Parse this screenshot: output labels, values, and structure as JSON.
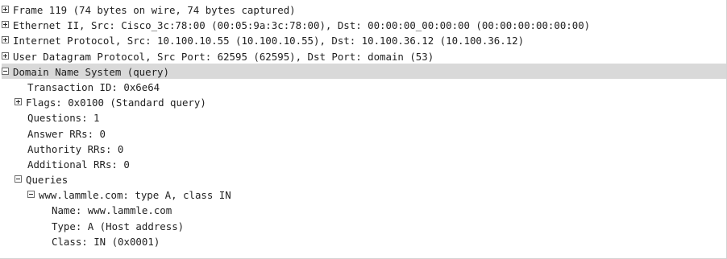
{
  "packet_details": {
    "rows": [
      {
        "text": "Frame 119 (74 bytes on wire, 74 bytes captured)",
        "expander": "collapsed"
      },
      {
        "text": "Ethernet II, Src: Cisco_3c:78:00 (00:05:9a:3c:78:00), Dst: 00:00:00_00:00:00 (00:00:00:00:00:00)",
        "expander": "collapsed"
      },
      {
        "text": "Internet Protocol, Src: 10.100.10.55 (10.100.10.55), Dst: 10.100.36.12 (10.100.36.12)",
        "expander": "collapsed"
      },
      {
        "text": "User Datagram Protocol, Src Port: 62595 (62595), Dst Port: domain (53)",
        "expander": "collapsed"
      },
      {
        "text": "Domain Name System (query)",
        "expander": "expanded",
        "selected": true
      },
      {
        "text": "Transaction ID: 0x6e64",
        "expander": "none"
      },
      {
        "text": "Flags: 0x0100 (Standard query)",
        "expander": "collapsed"
      },
      {
        "text": "Questions: 1",
        "expander": "none"
      },
      {
        "text": "Answer RRs: 0",
        "expander": "none"
      },
      {
        "text": "Authority RRs: 0",
        "expander": "none"
      },
      {
        "text": "Additional RRs: 0",
        "expander": "none"
      },
      {
        "text": "Queries",
        "expander": "expanded"
      },
      {
        "text": "www.lammle.com: type A, class IN",
        "expander": "expanded"
      },
      {
        "text": "Name: www.lammle.com",
        "expander": "none"
      },
      {
        "text": "Type: A (Host address)",
        "expander": "none"
      },
      {
        "text": "Class: IN (0x0001)",
        "expander": "none"
      }
    ]
  }
}
